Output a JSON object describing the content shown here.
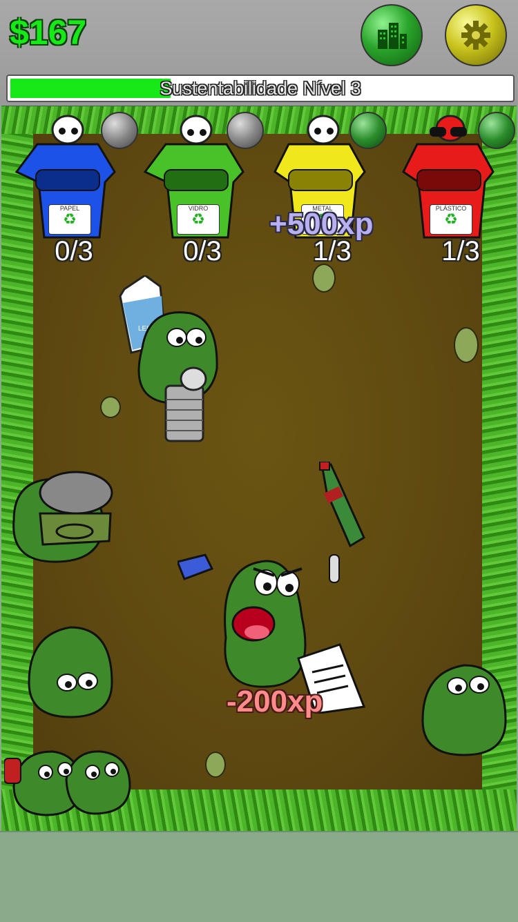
{
  "hud": {
    "money": "$167",
    "progress_label": "Sustentabilidade Nível 3",
    "progress_fraction": 0.32,
    "city_button_icon": "city-buildings-icon",
    "settings_button_icon": "gear-icon"
  },
  "bins": [
    {
      "label": "PAPEL",
      "count": "0/3",
      "color": "#1c52e8",
      "upgrade_active": false
    },
    {
      "label": "VIDRO",
      "count": "0/3",
      "color": "#49c22a",
      "upgrade_active": false
    },
    {
      "label": "METAL",
      "count": "1/3",
      "color": "#f1e81b",
      "upgrade_active": true
    },
    {
      "label": "PLÁSTICO",
      "count": "1/3",
      "color": "#e81b1b",
      "upgrade_active": true
    }
  ],
  "floating": {
    "xp_gain": "+500xp",
    "xp_loss": "-200xp"
  },
  "items": {
    "milk_label": "LEITE"
  },
  "colors": {
    "money": "#17e817",
    "progress_fill": "#17e817",
    "bottom_panel": "#8aaa8c"
  }
}
